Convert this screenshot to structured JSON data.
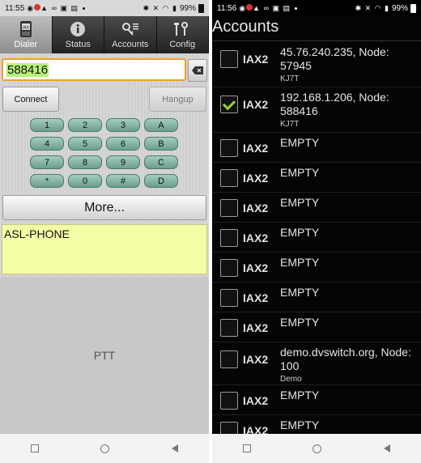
{
  "left": {
    "status_bar": {
      "time": "11:55",
      "battery": "99%"
    },
    "tabs": [
      {
        "label": "Dialer",
        "icon": "phone-iax-icon",
        "active": true
      },
      {
        "label": "Status",
        "icon": "info-icon",
        "active": false
      },
      {
        "label": "Accounts",
        "icon": "key-list-icon",
        "active": false
      },
      {
        "label": "Config",
        "icon": "tools-icon",
        "active": false
      }
    ],
    "dial_input": {
      "value": "588416"
    },
    "connect_label": "Connect",
    "hangup_label": "Hangup",
    "keypad": [
      "1",
      "2",
      "3",
      "A",
      "4",
      "5",
      "6",
      "B",
      "7",
      "8",
      "9",
      "C",
      "*",
      "0",
      "#",
      "D"
    ],
    "more_label": "More...",
    "status_text": "ASL-PHONE",
    "ptt_label": "PTT"
  },
  "right": {
    "status_bar": {
      "time": "11:56",
      "battery": "99%"
    },
    "title": "Accounts",
    "accounts": [
      {
        "proto": "IAX2",
        "host": "45.76.240.235, Node: 57945",
        "sub": "KJ7T",
        "checked": false
      },
      {
        "proto": "IAX2",
        "host": "192.168.1.206, Node: 588416",
        "sub": "KJ7T",
        "checked": true
      },
      {
        "proto": "IAX2",
        "host": "EMPTY",
        "sub": "",
        "checked": false
      },
      {
        "proto": "IAX2",
        "host": "EMPTY",
        "sub": "",
        "checked": false
      },
      {
        "proto": "IAX2",
        "host": "EMPTY",
        "sub": "",
        "checked": false
      },
      {
        "proto": "IAX2",
        "host": "EMPTY",
        "sub": "",
        "checked": false
      },
      {
        "proto": "IAX2",
        "host": "EMPTY",
        "sub": "",
        "checked": false
      },
      {
        "proto": "IAX2",
        "host": "EMPTY",
        "sub": "",
        "checked": false
      },
      {
        "proto": "IAX2",
        "host": "EMPTY",
        "sub": "",
        "checked": false
      },
      {
        "proto": "IAX2",
        "host": "demo.dvswitch.org, Node: 100",
        "sub": "Demo",
        "checked": false
      },
      {
        "proto": "IAX2",
        "host": "EMPTY",
        "sub": "",
        "checked": false
      },
      {
        "proto": "IAX2",
        "host": "EMPTY",
        "sub": "",
        "checked": false
      }
    ]
  },
  "colors": {
    "accent_green": "#9ad13a",
    "input_highlight": "#b6f27a",
    "input_border": "#f0a030",
    "status_box": "#f4fca6",
    "keypad_key": "#8fbcae"
  }
}
